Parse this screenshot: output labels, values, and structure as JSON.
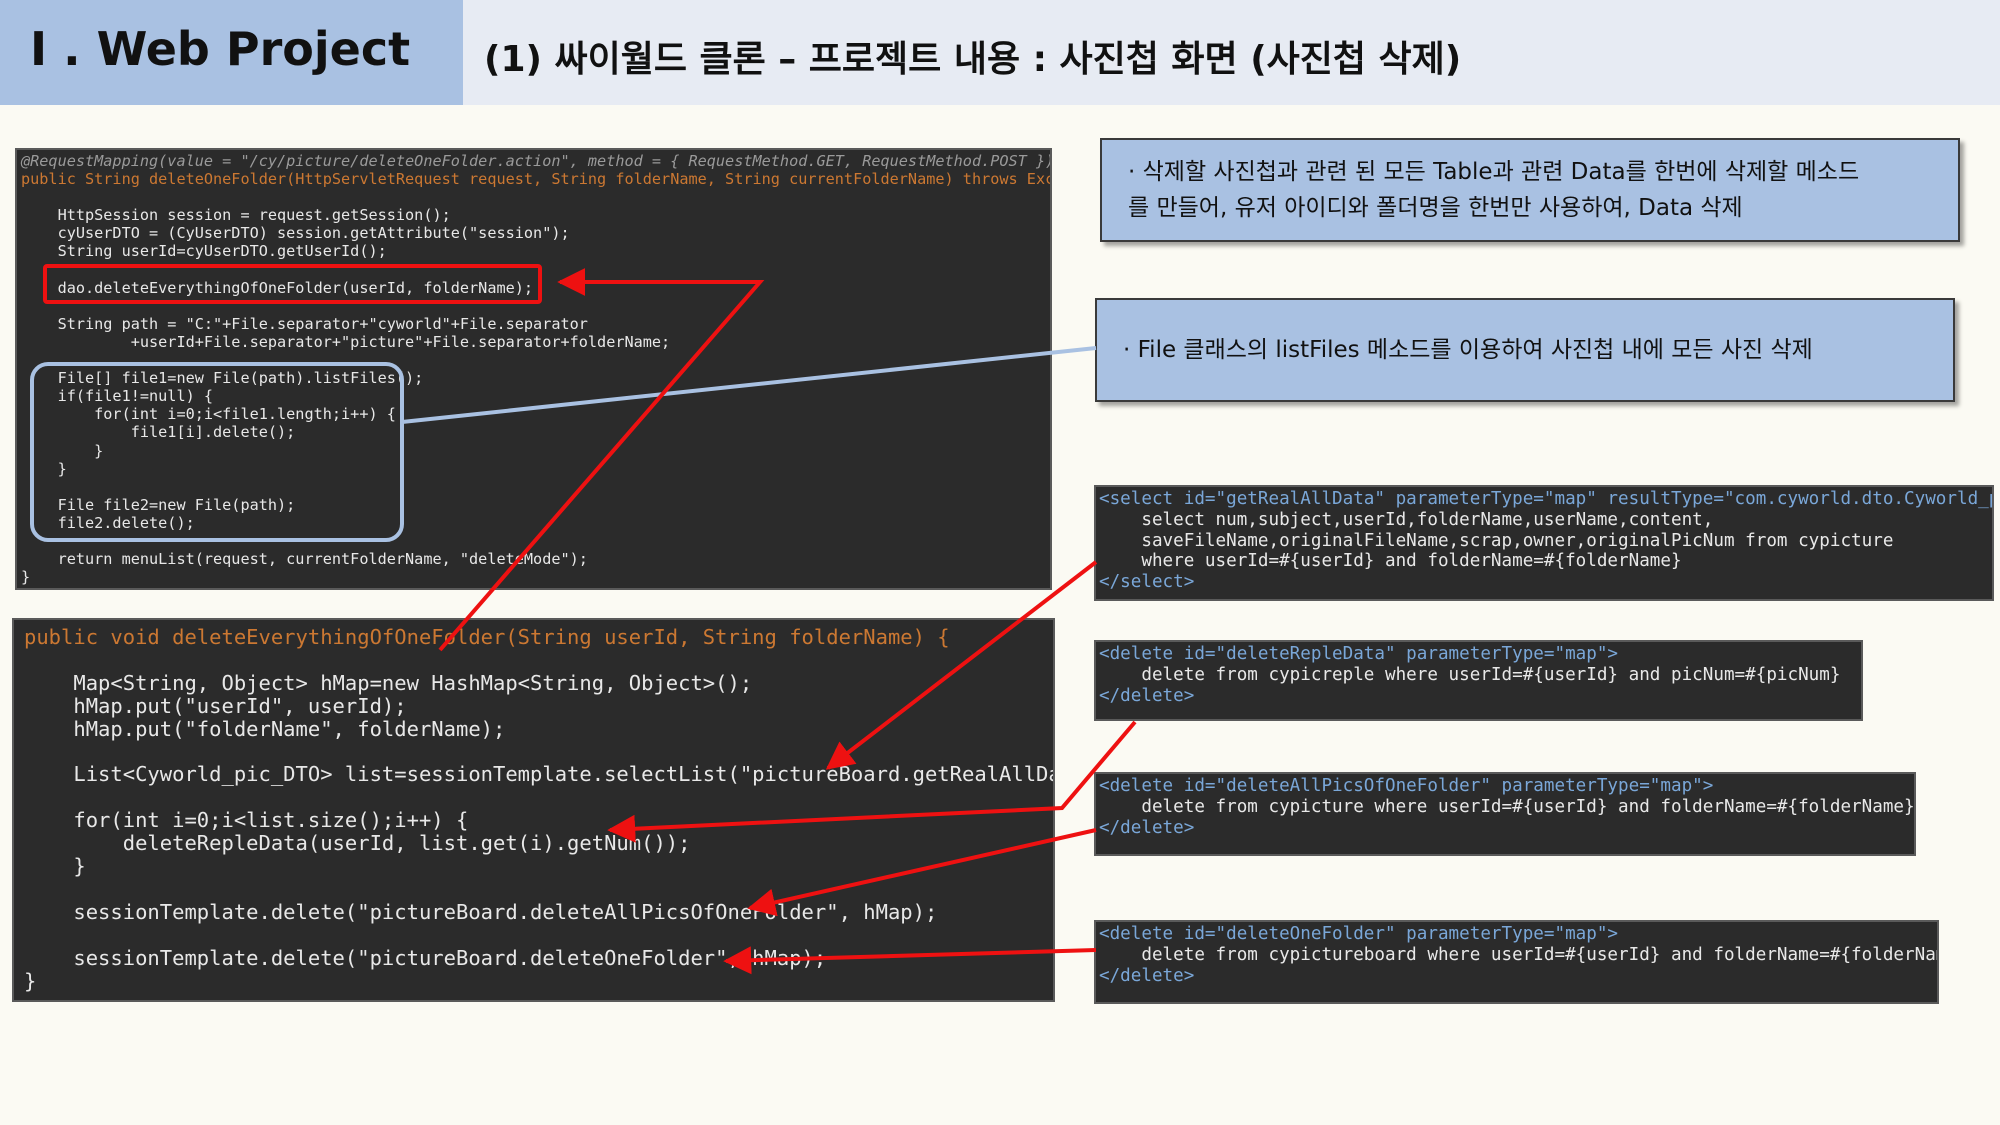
{
  "header": {
    "section_title": "I . Web Project",
    "page_title": "(1) 싸이월드 클론 – 프로젝트 내용 : 사진첩 화면 (사진첩 삭제)"
  },
  "notes": {
    "note1": "· 삭제할 사진첩과 관련 된 모든 Table과 관련 Data를 한번에 삭제할 메소드\n를 만들어, 유저 아이디와 폴더명을 한번만 사용하여, Data 삭제",
    "note2": "· File 클래스의 listFiles 메소드를 이용하여 사진첩 내에 모든 사진 삭제"
  },
  "code": {
    "controller": {
      "l1": "@RequestMapping(value = \"/cy/picture/deleteOneFolder.action\", method = { RequestMethod.GET, RequestMethod.POST })",
      "l2": "public String deleteOneFolder(HttpServletRequest request, String folderName, String currentFolderName) throws Exception {",
      "l3": "    HttpSession session = request.getSession();",
      "l4": "    cyUserDTO = (CyUserDTO) session.getAttribute(\"session\");",
      "l5": "    String userId=cyUserDTO.getUserId();",
      "l6": "    dao.deleteEverythingOfOneFolder(userId, folderName);",
      "l7": "    String path = \"C:\"+File.separator+\"cyworld\"+File.separator",
      "l8": "            +userId+File.separator+\"picture\"+File.separator+folderName;",
      "l9": "    File[] file1=new File(path).listFiles();",
      "l10": "    if(file1!=null) {",
      "l11": "        for(int i=0;i<file1.length;i++) {",
      "l12": "            file1[i].delete();",
      "l13": "        }",
      "l14": "    }",
      "l15": "    File file2=new File(path);",
      "l16": "    file2.delete();",
      "l17": "    return menuList(request, currentFolderName, \"deleteMode\");",
      "l18": "}"
    },
    "dao": {
      "l1": "public void deleteEverythingOfOneFolder(String userId, String folderName) {",
      "l2": "    Map<String, Object> hMap=new HashMap<String, Object>();",
      "l3": "    hMap.put(\"userId\", userId);",
      "l4": "    hMap.put(\"folderName\", folderName);",
      "l5": "    List<Cyworld_pic_DTO> list=sessionTemplate.selectList(\"pictureBoard.getRealAllData\", hMap);",
      "l6": "    for(int i=0;i<list.size();i++) {",
      "l7": "        deleteRepleData(userId, list.get(i).getNum());",
      "l8": "    }",
      "l9": "    sessionTemplate.delete(\"pictureBoard.deleteAllPicsOfOneFolder\", hMap);",
      "l10": "    sessionTemplate.delete(\"pictureBoard.deleteOneFolder\", hMap);",
      "l11": "}"
    },
    "sql_select": {
      "l1": "<select id=\"getRealAllData\" parameterType=\"map\" resultType=\"com.cyworld.dto.Cyworld_pic_DTO\">",
      "l2": "    select num,subject,userId,folderName,userName,content,",
      "l3": "    saveFileName,originalFileName,scrap,owner,originalPicNum from cypicture",
      "l4": "    where userId=#{userId} and folderName=#{folderName}",
      "l5": "</select>"
    },
    "sql_delete_reple": {
      "l1": "<delete id=\"deleteRepleData\" parameterType=\"map\">",
      "l2": "    delete from cypicreple where userId=#{userId} and picNum=#{picNum}",
      "l3": "</delete>"
    },
    "sql_delete_pics": {
      "l1": "<delete id=\"deleteAllPicsOfOneFolder\" parameterType=\"map\">",
      "l2": "    delete from cypicture where userId=#{userId} and folderName=#{folderName}",
      "l3": "</delete>"
    },
    "sql_delete_folder": {
      "l1": "<delete id=\"deleteOneFolder\" parameterType=\"map\">",
      "l2": "    delete from cypictureboard where userId=#{userId} and folderName=#{folderName}",
      "l3": "</delete>"
    }
  },
  "colors": {
    "header_accent": "#a9c1e2",
    "header_bg": "#e7ebf3",
    "code_bg": "#2b2b2b",
    "arrow_red": "#ee1111",
    "callout_blue": "#a9c1e2"
  }
}
